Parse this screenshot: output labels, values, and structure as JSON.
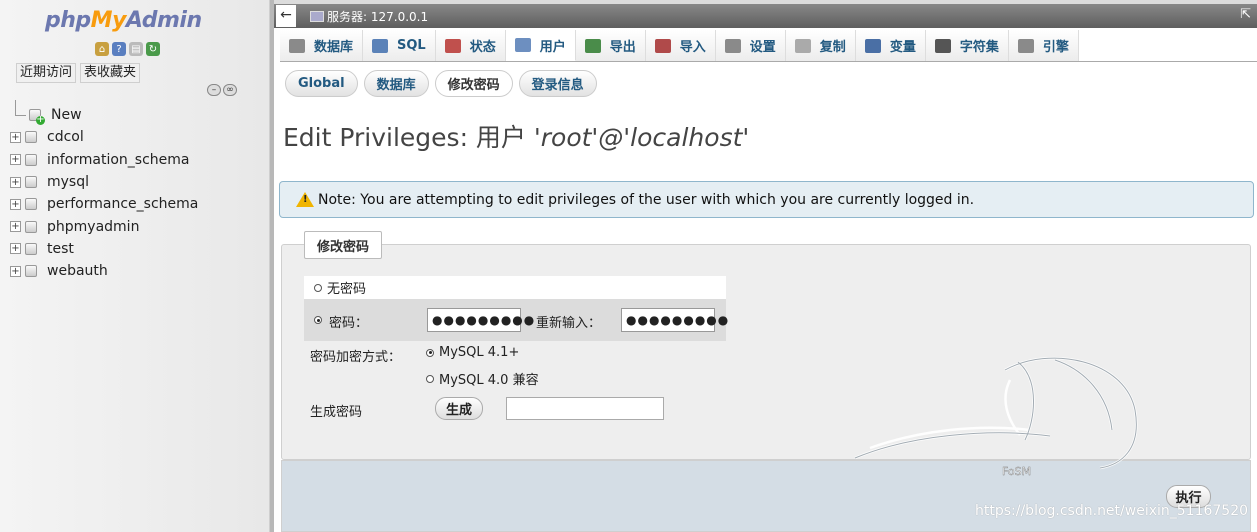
{
  "logo": {
    "php": "php",
    "my": "My",
    "admin": "Admin"
  },
  "nav": {
    "tabs": [
      "近期访问",
      "表收藏夹"
    ],
    "databases": [
      {
        "name": "New",
        "is_new": true
      },
      {
        "name": "cdcol"
      },
      {
        "name": "information_schema"
      },
      {
        "name": "mysql"
      },
      {
        "name": "performance_schema"
      },
      {
        "name": "phpmyadmin"
      },
      {
        "name": "test"
      },
      {
        "name": "webauth"
      }
    ]
  },
  "serverbar": {
    "back_symbol": "←",
    "label": "服务器: 127.0.0.1",
    "pin_symbol": "⇱"
  },
  "tabs": [
    {
      "label": "数据库",
      "icon": "database-icon",
      "color": "#8a8a8a"
    },
    {
      "label": "SQL",
      "icon": "sql-icon",
      "color": "#5b82b8"
    },
    {
      "label": "状态",
      "icon": "status-icon",
      "color": "#c0504d"
    },
    {
      "label": "用户",
      "icon": "users-icon",
      "color": "#6d8fc0",
      "active": true
    },
    {
      "label": "导出",
      "icon": "export-icon",
      "color": "#4a8c4a"
    },
    {
      "label": "导入",
      "icon": "import-icon",
      "color": "#b04a4a"
    },
    {
      "label": "设置",
      "icon": "wrench-icon",
      "color": "#8a8a8a"
    },
    {
      "label": "复制",
      "icon": "replication-icon",
      "color": "#aaaaaa"
    },
    {
      "label": "变量",
      "icon": "variables-icon",
      "color": "#4a6fa5"
    },
    {
      "label": "字符集",
      "icon": "charset-icon",
      "color": "#555555"
    },
    {
      "label": "引擎",
      "icon": "engine-icon",
      "color": "#8a8a8a"
    }
  ],
  "subtabs": [
    {
      "label": "Global"
    },
    {
      "label": "数据库"
    },
    {
      "label": "修改密码",
      "active": true
    },
    {
      "label": "登录信息"
    }
  ],
  "heading": {
    "prefix": "Edit Privileges: 用户 ",
    "user": "'root'@'localhost'"
  },
  "notice": "Note: You are attempting to edit privileges of the user with which you are currently logged in.",
  "form": {
    "legend": "修改密码",
    "no_password_label": "无密码",
    "password_label": "密码：",
    "password_value": "●●●●●●●●●",
    "retype_label": "重新输入：",
    "retype_value": "●●●●●●●●●",
    "hashing_label": "密码加密方式：",
    "hashing_options": [
      {
        "label": "MySQL 4.1+",
        "selected": true
      },
      {
        "label": "MySQL 4.0 兼容",
        "selected": false
      }
    ],
    "generate_label": "生成密码",
    "generate_button": "生成",
    "submit_button": "执行"
  },
  "watermark": {
    "brand": "FoSM",
    "url": "https://blog.csdn.net/weixin_51167520"
  },
  "colors": {
    "logo_blue": "#6c78af",
    "logo_orange": "#f89c0e",
    "link_blue": "#235a81",
    "notice_bg": "#e5eef3"
  }
}
